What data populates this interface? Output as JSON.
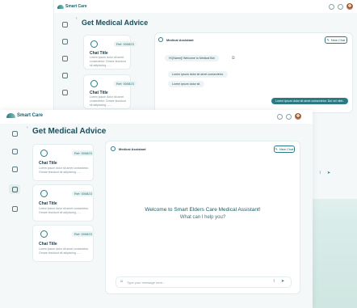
{
  "app": {
    "name": "Smart Care"
  },
  "page": {
    "title": "Get Medical Advice"
  },
  "chat": {
    "assistant_name": "Medical Assistant",
    "new_chat_label": "New Chat",
    "input_placeholder": "Type your message here...",
    "welcome_title": "Welcome to Smart Elders Care Medical Assistant!",
    "welcome_subtitle": "What can I help you?",
    "messages": [
      {
        "role": "ai",
        "text": "Hi [Name]! Welcome to Medical Bot"
      },
      {
        "role": "ai",
        "text": "Lorem ipsum dolor sit amet consectetur."
      },
      {
        "role": "ai",
        "text": "Lorem ipsum dolor sit."
      },
      {
        "role": "user",
        "text": "Lorem ipsum dolor sit amet consectetur. Dui vel nibh."
      }
    ]
  },
  "cards": [
    {
      "ref": "Ref: 000823",
      "title": "Chat Title",
      "body": "Lorem ipsum dolor sit amet consectetur. Ornare tincidunt sit adipiscing......."
    },
    {
      "ref": "Ref: 000823",
      "title": "Chat Title",
      "body": "Lorem ipsum dolor sit amet consectetur. Ornare tincidunt sit adipiscing......."
    },
    {
      "ref": "Ref: 000823",
      "title": "Chat Title",
      "body": "Lorem ipsum dolor sit amet consectetur. Ornare tincidunt sit adipiscing......."
    }
  ],
  "colors": {
    "brand": "#2a7a86",
    "accent_bg": "#e1f0ee"
  },
  "icons": {
    "logo": "care-logo-icon",
    "send": "send-icon",
    "attach": "attach-icon",
    "new_chat": "edit-icon"
  }
}
